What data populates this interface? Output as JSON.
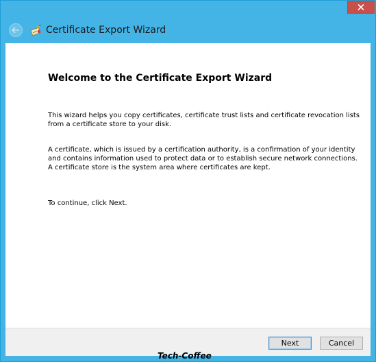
{
  "window": {
    "title": "Certificate Export Wizard",
    "accent_color": "#44b4e6",
    "close_color": "#c7504b"
  },
  "icons": {
    "back": "back-arrow-icon",
    "wizard": "certificate-wizard-icon",
    "close": "close-icon"
  },
  "page": {
    "heading": "Welcome to the Certificate Export Wizard",
    "paragraph1": "This wizard helps you copy certificates, certificate trust lists and certificate revocation lists from a certificate store to your disk.",
    "paragraph2": "A certificate, which is issued by a certification authority, is a confirmation of your identity and contains information used to protect data or to establish secure network connections. A certificate store is the system area where certificates are kept.",
    "paragraph3": "To continue, click Next."
  },
  "buttons": {
    "next_label": "Next",
    "cancel_label": "Cancel"
  },
  "watermark": "Tech-Coffee"
}
